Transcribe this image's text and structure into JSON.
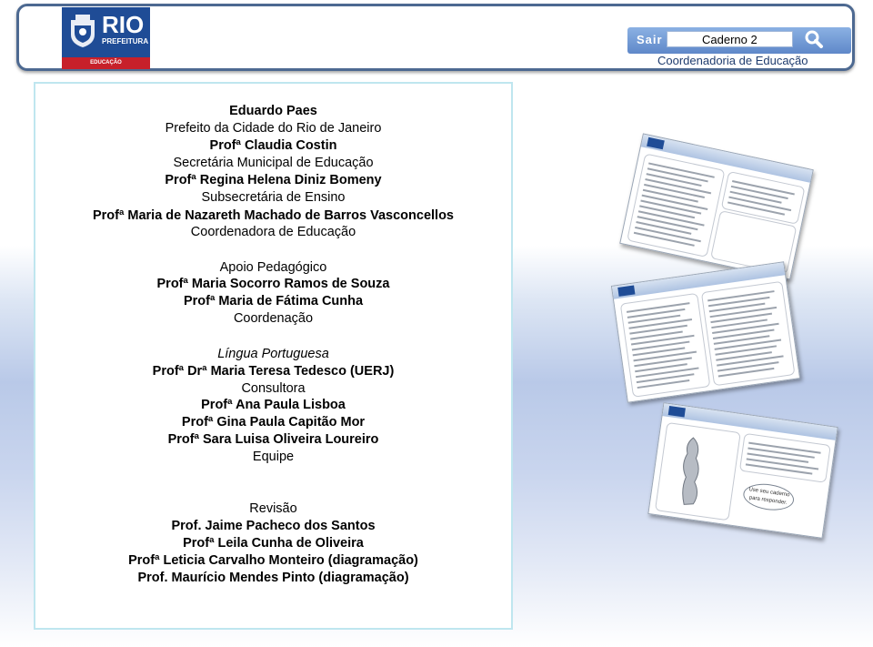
{
  "header": {
    "logo": {
      "title": "RIO",
      "subtitle": "PREFEITURA",
      "band": "EDUCAÇÃO"
    },
    "exit_label": "Sair",
    "search_value": "Caderno 2",
    "search_icon": "magnifier-icon",
    "department": "Coordenadoria de Educação"
  },
  "credits": [
    {
      "text": "Eduardo Paes",
      "style": "bold"
    },
    {
      "text": "Prefeito da Cidade do Rio de Janeiro",
      "style": "normal"
    },
    {
      "text": "Profª Claudia Costin",
      "style": "bold"
    },
    {
      "text": "Secretária Municipal de Educação",
      "style": "normal"
    },
    {
      "text": "Profª Regina Helena Diniz Bomeny",
      "style": "bold"
    },
    {
      "text": "Subsecretária de Ensino",
      "style": "normal"
    },
    {
      "text": "Profª Maria de Nazareth Machado de Barros Vasconcellos",
      "style": "bold"
    },
    {
      "text": "Coordenadora de Educação",
      "style": "normal"
    },
    {
      "text": "Apoio Pedagógico",
      "style": "normal"
    },
    {
      "text": "Profª Maria Socorro Ramos de Souza",
      "style": "bold"
    },
    {
      "text": "Profª Maria de Fátima Cunha",
      "style": "bold"
    },
    {
      "text": "Coordenação",
      "style": "normal"
    },
    {
      "text": "Língua Portuguesa",
      "style": "italic"
    },
    {
      "text": "Profª Drª Maria Teresa Tedesco (UERJ)",
      "style": "bold"
    },
    {
      "text": "Consultora",
      "style": "normal"
    },
    {
      "text": "Profª Ana Paula Lisboa",
      "style": "bold"
    },
    {
      "text": "Profª Gina Paula Capitão Mor",
      "style": "bold"
    },
    {
      "text": "Profª Sara Luisa Oliveira Loureiro",
      "style": "bold"
    },
    {
      "text": "Equipe",
      "style": "normal"
    },
    {
      "text": "Revisão",
      "style": "normal"
    },
    {
      "text": "Prof. Jaime Pacheco dos Santos",
      "style": "bold"
    },
    {
      "text": "Profª Leila Cunha de Oliveira",
      "style": "bold"
    },
    {
      "text": "Profª Leticia Carvalho Monteiro (diagramação)",
      "style": "bold"
    },
    {
      "text": "Prof. Maurício Mendes Pinto (diagramação)",
      "style": "bold"
    }
  ],
  "preview": {
    "bubble": "Use seu caderno para responder."
  },
  "colors": {
    "brand_blue": "#1f4c96",
    "brand_red": "#c7202a",
    "frame": "#4d6991",
    "panel_border": "#bfe6ef"
  }
}
